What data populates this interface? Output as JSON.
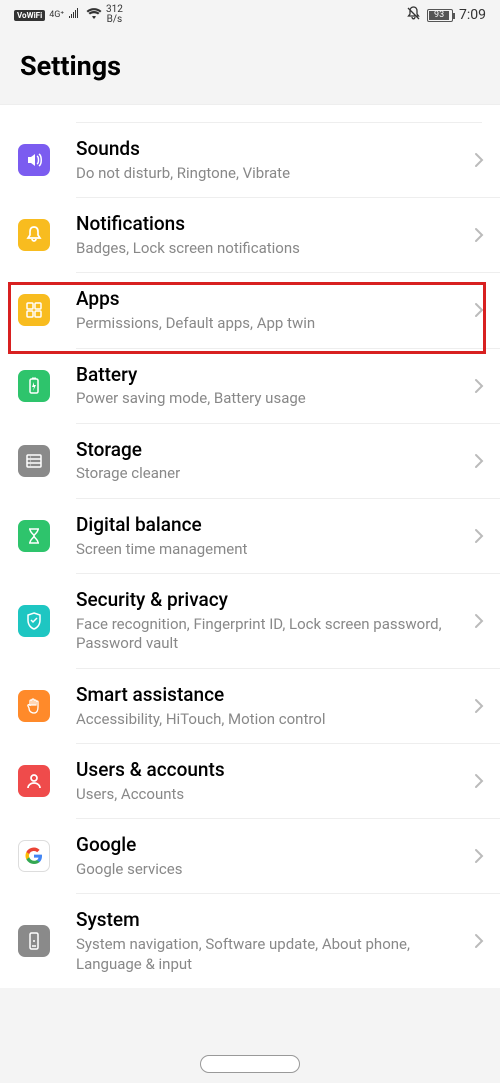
{
  "status_bar": {
    "vowifi": "VoWiFi",
    "net": "4G⁺",
    "speed_top": "312",
    "speed_bot": "B/s",
    "battery": "93",
    "time": "7:09"
  },
  "header": {
    "title": "Settings"
  },
  "items": [
    {
      "id": "sounds",
      "label": "Sounds",
      "sub": "Do not disturb, Ringtone, Vibrate",
      "bg": "bg-purple",
      "icon": "speaker"
    },
    {
      "id": "notifications",
      "label": "Notifications",
      "sub": "Badges, Lock screen notifications",
      "bg": "bg-yellow",
      "icon": "bell"
    },
    {
      "id": "apps",
      "label": "Apps",
      "sub": "Permissions, Default apps, App twin",
      "bg": "bg-yellow",
      "icon": "grid",
      "highlighted": true
    },
    {
      "id": "battery",
      "label": "Battery",
      "sub": "Power saving mode, Battery usage",
      "bg": "bg-green",
      "icon": "battery"
    },
    {
      "id": "storage",
      "label": "Storage",
      "sub": "Storage cleaner",
      "bg": "bg-gray",
      "icon": "storage"
    },
    {
      "id": "digital-balance",
      "label": "Digital balance",
      "sub": "Screen time management",
      "bg": "bg-green",
      "icon": "hourglass"
    },
    {
      "id": "security",
      "label": "Security & privacy",
      "sub": "Face recognition, Fingerprint ID, Lock screen password, Password vault",
      "bg": "bg-teal",
      "icon": "shield"
    },
    {
      "id": "smart-assist",
      "label": "Smart assistance",
      "sub": "Accessibility, HiTouch, Motion control",
      "bg": "bg-orange",
      "icon": "hand"
    },
    {
      "id": "users",
      "label": "Users & accounts",
      "sub": "Users, Accounts",
      "bg": "bg-red",
      "icon": "person"
    },
    {
      "id": "google",
      "label": "Google",
      "sub": "Google services",
      "bg": "bg-white",
      "icon": "google"
    },
    {
      "id": "system",
      "label": "System",
      "sub": "System navigation, Software update, About phone, Language & input",
      "bg": "bg-gray",
      "icon": "system"
    }
  ]
}
